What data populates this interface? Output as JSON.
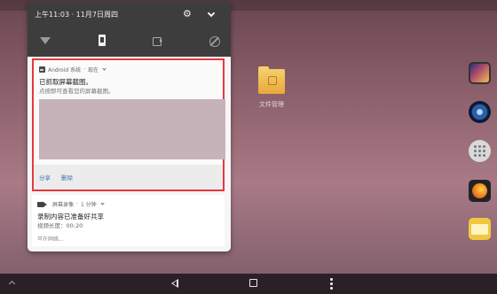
{
  "quick_settings": {
    "datetime": "上午11:03 · 11月7日周四",
    "icons": [
      "gear-icon",
      "chevron-down-icon",
      "wifi-off-icon",
      "phone-screen-icon",
      "screen-record-icon",
      "cast-off-icon"
    ]
  },
  "notifications": [
    {
      "app": "Android 系统",
      "time": "现在",
      "title": "已抓取屏幕截图。",
      "body": "点按即可查看您的屏幕截图。",
      "actions": [
        "分享",
        "删除"
      ]
    },
    {
      "app": "屏幕录像",
      "time": "1 分钟",
      "title": "录制内容已准备好共享",
      "body": "视频长度：00:20",
      "truncated": "可在网络..."
    }
  ],
  "desktop": {
    "folder_label": "文件管理"
  },
  "colors": {
    "highlight_border": "#e8383d",
    "shade_header": "#3d3d3d",
    "action_text": "#3d6fb0",
    "navbar": "#2c2027"
  }
}
